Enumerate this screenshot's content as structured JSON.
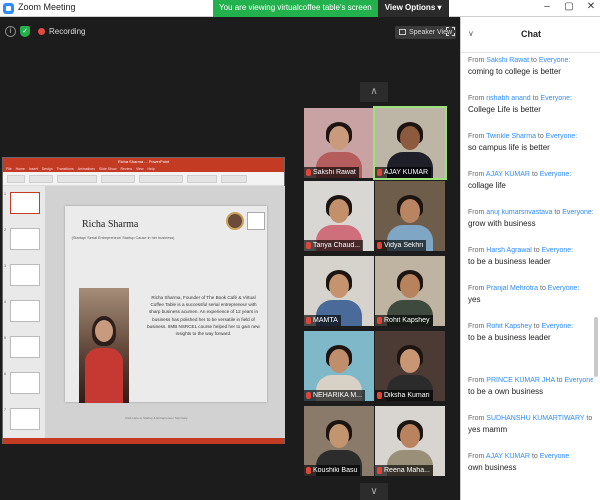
{
  "window": {
    "title": "Zoom Meeting",
    "minimize": "–",
    "maximize": "▢",
    "close": "✕"
  },
  "banner": {
    "text": "You are viewing virtualcoffee table's screen",
    "view_options": "View Options ▾"
  },
  "toolbar": {
    "info_icon": "i",
    "shield_icon": "✓",
    "recording_label": "Recording",
    "speaker_view_label": "Speaker View"
  },
  "gallery": {
    "up": "∧",
    "down": "∨",
    "tiles": [
      {
        "name": "Sakshi Rawat",
        "bg": "#c9a3a3",
        "head": "#c99a7c",
        "torso": "#b55d5d"
      },
      {
        "name": "AJAY KUMAR",
        "bg": "#bdb6a6",
        "head": "#8c5b3f",
        "torso": "#1f1f2a"
      },
      {
        "name": "Tanya Chaud...",
        "bg": "#d9d7d4",
        "head": "#c3906c",
        "torso": "#cf6f7b"
      },
      {
        "name": "Vidya Sekhri",
        "bg": "#6f5d4c",
        "head": "#b98462",
        "torso": "#7fa6c4"
      },
      {
        "name": "MAMTA",
        "bg": "#d6d2cc",
        "head": "#c5946f",
        "torso": "#4a6b9a"
      },
      {
        "name": "Rohit Kapshey",
        "bg": "#bfb3a1",
        "head": "#b7835d",
        "torso": "#3e4a3e"
      },
      {
        "name": "NEHARIKA M...",
        "bg": "#7eb8c9",
        "head": "#c08e6a",
        "torso": "#d8d2c6"
      },
      {
        "name": "Diksha Kumari",
        "bg": "#4b3b34",
        "head": "#c89673",
        "torso": "#2b2b2b"
      },
      {
        "name": "Koushiki Basu",
        "bg": "#8a7a6a",
        "head": "#c29570",
        "torso": "#2c2c2c"
      },
      {
        "name": "Reena Maha...",
        "bg": "#d8d4cf",
        "head": "#b9835f",
        "torso": "#9a8f78"
      }
    ]
  },
  "presentation": {
    "window_title": "Richa Sharma ... PowerPoint",
    "tabs": [
      "File",
      "Home",
      "Insert",
      "Design",
      "Transitions",
      "Animations",
      "Slide Show",
      "Review",
      "View",
      "Help"
    ],
    "thumb_numbers": [
      "1",
      "2",
      "3",
      "4",
      "5",
      "6",
      "7"
    ],
    "slide": {
      "name": "Richa Sharma",
      "subtitle": "(Startup/ Serial Entrepreneur/ Startup Cause in her business)",
      "bio": "Richa Sharma, Founder of The Book Café & Virtual Coffee Table is a successful serial entrepreneur with sharp business acumen. An experience of 12 years in business has polished her to be versatile in field of business. IIMB NSRCEL course helped her to gain new insights to the way forward.",
      "footer": "Click Here to Startup & Entrepreneur Summary"
    }
  },
  "chat": {
    "title": "Chat",
    "collapse_icon": "∨",
    "from_prefix": "From",
    "to_prefix": "to",
    "messages": [
      {
        "from": "Sakshi Rawat",
        "to": "Everyone:",
        "text": "coming to college is better"
      },
      {
        "from": "rishabh anand",
        "to": "Everyone:",
        "text": "College Life is better"
      },
      {
        "from": "Twinkle Sharma",
        "to": "Everyone:",
        "text": "so campus life is better"
      },
      {
        "from": "AJAY KUMAR",
        "to": "Everyone:",
        "text": "collage life"
      },
      {
        "from": "anuj kumarsrivastava",
        "to": "Everyone:",
        "text": "grow with business"
      },
      {
        "from": "Harsh Agrawal",
        "to": "Everyone:",
        "text": "to be a business leader"
      },
      {
        "from": "Pranjal Mehrotra",
        "to": "Everyone:",
        "text": "yes"
      },
      {
        "from": "Rohit Kapshey",
        "to": "Everyone:",
        "text": "to be a business leader"
      },
      {
        "from": "PRINCE KUMAR JHA",
        "to": "Everyone:",
        "text": "to be a own business"
      },
      {
        "from": "SUDHANSHU KUMARTIWARY",
        "to": "Everyone:",
        "text": "yes mamm"
      },
      {
        "from": "AJAY KUMAR",
        "to": "Everyone",
        "text": "own business"
      }
    ]
  }
}
